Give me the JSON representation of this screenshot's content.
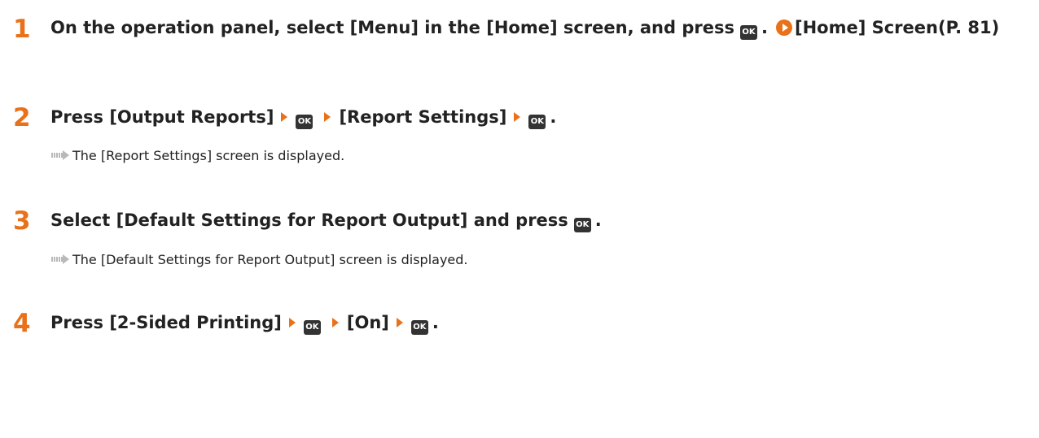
{
  "steps": [
    {
      "number": "1",
      "text_before": "On the operation panel, select [Menu] in the [Home] screen, and press",
      "ok_label": "OK",
      "period": ".",
      "link_text": "[Home] Screen(P. 81)"
    },
    {
      "number": "2",
      "press_word": "Press",
      "item1": "[Output Reports]",
      "ok_label": "OK",
      "item2": "[Report Settings]",
      "period": ".",
      "result": "The [Report Settings] screen is displayed."
    },
    {
      "number": "3",
      "text_before": "Select [Default Settings for Report Output] and press",
      "ok_label": "OK",
      "period": ".",
      "result": "The [Default Settings for Report Output] screen is displayed."
    },
    {
      "number": "4",
      "press_word": "Press",
      "item1": "[2-Sided Printing]",
      "ok_label": "OK",
      "item2": "[On]",
      "period": "."
    }
  ],
  "colors": {
    "accent": "#e8711a",
    "text": "#222222",
    "ok_key_bg": "#333333",
    "result_arrow": "#b9b9b9"
  },
  "icons": {
    "ok_key": "ok-key-icon",
    "step_arrow": "right-triangle-icon",
    "link": "link-arrow-icon",
    "result": "result-arrow-icon"
  }
}
